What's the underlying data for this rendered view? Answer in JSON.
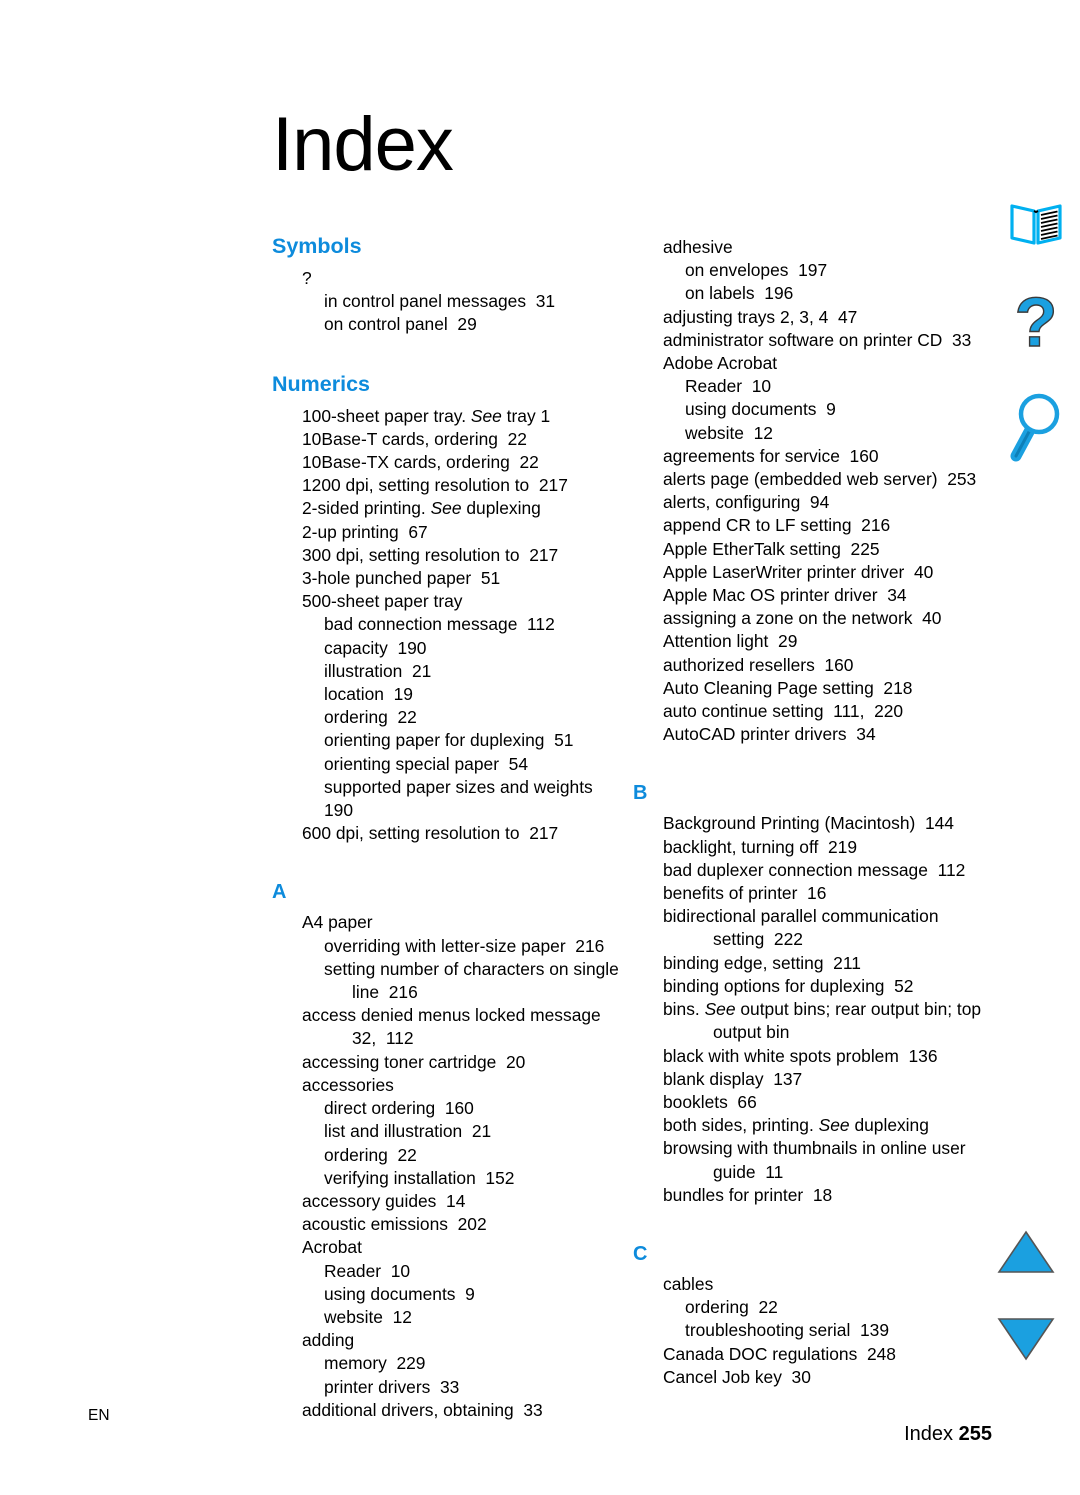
{
  "page": {
    "title": "Index",
    "footer_left": "EN",
    "footer_label": "Index",
    "footer_page": "255"
  },
  "theme": {
    "heading_blue": "#0d8bdc",
    "icon_blue": "#1ba0e0",
    "text_black": "#000000",
    "background": "#ffffff"
  },
  "icons": [
    {
      "name": "open-book-icon",
      "label": "open book"
    },
    {
      "name": "question-mark-icon",
      "label": "question mark"
    },
    {
      "name": "magnifier-icon",
      "label": "magnifying glass"
    },
    {
      "name": "triangle-up-icon",
      "label": "previous page"
    },
    {
      "name": "triangle-down-icon",
      "label": "next page"
    }
  ],
  "columns": {
    "left": [
      {
        "heading": "Symbols",
        "heading_style": "word",
        "entries": [
          {
            "level": 0,
            "text": "?"
          },
          {
            "level": 1,
            "text": "in control panel messages  31"
          },
          {
            "level": 1,
            "text": "on control panel  29"
          }
        ]
      },
      {
        "heading": "Numerics",
        "heading_style": "word",
        "entries": [
          {
            "level": 0,
            "text": "100-sheet paper tray. ",
            "italic": "See",
            "text2": " tray 1"
          },
          {
            "level": 0,
            "text": "10Base-T cards, ordering  22"
          },
          {
            "level": 0,
            "text": "10Base-TX cards, ordering  22"
          },
          {
            "level": 0,
            "text": "1200 dpi, setting resolution to  217"
          },
          {
            "level": 0,
            "text": "2-sided printing. ",
            "italic": "See",
            "text2": " duplexing"
          },
          {
            "level": 0,
            "text": "2-up printing  67"
          },
          {
            "level": 0,
            "text": "300 dpi, setting resolution to  217"
          },
          {
            "level": 0,
            "text": "3-hole punched paper  51"
          },
          {
            "level": 0,
            "text": "500-sheet paper tray"
          },
          {
            "level": 1,
            "text": "bad connection message  112"
          },
          {
            "level": 1,
            "text": "capacity  190"
          },
          {
            "level": 1,
            "text": "illustration  21"
          },
          {
            "level": 1,
            "text": "location  19"
          },
          {
            "level": 1,
            "text": "ordering  22"
          },
          {
            "level": 1,
            "text": "orienting paper for duplexing  51"
          },
          {
            "level": 1,
            "text": "orienting special paper  54"
          },
          {
            "level": 1,
            "text": "supported paper sizes and weights  190"
          },
          {
            "level": 0,
            "text": "600 dpi, setting resolution to  217"
          }
        ]
      },
      {
        "heading": "A",
        "heading_style": "letter",
        "entries": [
          {
            "level": 0,
            "text": "A4 paper"
          },
          {
            "level": 1,
            "text": "overriding with letter-size paper  216"
          },
          {
            "level": 1,
            "text": "setting number of characters on single"
          },
          {
            "level": 2,
            "text": "line  216"
          },
          {
            "level": 0,
            "text": "access denied menus locked message"
          },
          {
            "level": 2,
            "text": "32,  112"
          },
          {
            "level": 0,
            "text": "accessing toner cartridge  20"
          },
          {
            "level": 0,
            "text": "accessories"
          },
          {
            "level": 1,
            "text": "direct ordering  160"
          },
          {
            "level": 1,
            "text": "list and illustration  21"
          },
          {
            "level": 1,
            "text": "ordering  22"
          },
          {
            "level": 1,
            "text": "verifying installation  152"
          },
          {
            "level": 0,
            "text": "accessory guides  14"
          },
          {
            "level": 0,
            "text": "acoustic emissions  202"
          },
          {
            "level": 0,
            "text": "Acrobat"
          },
          {
            "level": 1,
            "text": "Reader  10"
          },
          {
            "level": 1,
            "text": "using documents  9"
          },
          {
            "level": 1,
            "text": "website  12"
          },
          {
            "level": 0,
            "text": "adding"
          },
          {
            "level": 1,
            "text": "memory  229"
          },
          {
            "level": 1,
            "text": "printer drivers  33"
          },
          {
            "level": 0,
            "text": "additional drivers, obtaining  33"
          }
        ]
      }
    ],
    "right": [
      {
        "heading": "",
        "heading_style": "none",
        "entries": [
          {
            "level": 0,
            "text": "adhesive"
          },
          {
            "level": 1,
            "text": "on envelopes  197"
          },
          {
            "level": 1,
            "text": "on labels  196"
          },
          {
            "level": 0,
            "text": "adjusting trays 2, 3, 4  47"
          },
          {
            "level": 0,
            "text": "administrator software on printer CD  33"
          },
          {
            "level": 0,
            "text": "Adobe Acrobat"
          },
          {
            "level": 1,
            "text": "Reader  10"
          },
          {
            "level": 1,
            "text": "using documents  9"
          },
          {
            "level": 1,
            "text": "website  12"
          },
          {
            "level": 0,
            "text": "agreements for service  160"
          },
          {
            "level": 0,
            "text": "alerts page (embedded web server)  253"
          },
          {
            "level": 0,
            "text": "alerts, configuring  94"
          },
          {
            "level": 0,
            "text": "append CR to LF setting  216"
          },
          {
            "level": 0,
            "text": "Apple EtherTalk setting  225"
          },
          {
            "level": 0,
            "text": "Apple LaserWriter printer driver  40"
          },
          {
            "level": 0,
            "text": "Apple Mac OS printer driver  34"
          },
          {
            "level": 0,
            "text": "assigning a zone on the network  40"
          },
          {
            "level": 0,
            "text": "Attention light  29"
          },
          {
            "level": 0,
            "text": "authorized resellers  160"
          },
          {
            "level": 0,
            "text": "Auto Cleaning Page setting  218"
          },
          {
            "level": 0,
            "text": "auto continue setting  111,  220"
          },
          {
            "level": 0,
            "text": "AutoCAD printer drivers  34"
          }
        ]
      },
      {
        "heading": "B",
        "heading_style": "letter",
        "entries": [
          {
            "level": 0,
            "text": "Background Printing (Macintosh)  144"
          },
          {
            "level": 0,
            "text": "backlight, turning off  219"
          },
          {
            "level": 0,
            "text": "bad duplexer connection message  112"
          },
          {
            "level": 0,
            "text": "benefits of printer  16"
          },
          {
            "level": 0,
            "text": "bidirectional parallel communication"
          },
          {
            "level": 2,
            "text": "setting  222"
          },
          {
            "level": 0,
            "text": "binding edge, setting  211"
          },
          {
            "level": 0,
            "text": "binding options for duplexing  52"
          },
          {
            "level": 0,
            "text": "bins. ",
            "italic": "See",
            "text2": " output bins; rear output bin; top"
          },
          {
            "level": 2,
            "text": "output bin"
          },
          {
            "level": 0,
            "text": "black with white spots problem  136"
          },
          {
            "level": 0,
            "text": "blank display  137"
          },
          {
            "level": 0,
            "text": "booklets  66"
          },
          {
            "level": 0,
            "text": "both sides, printing. ",
            "italic": "See",
            "text2": " duplexing"
          },
          {
            "level": 0,
            "text": "browsing with thumbnails in online user"
          },
          {
            "level": 2,
            "text": "guide  11"
          },
          {
            "level": 0,
            "text": "bundles for printer  18"
          }
        ]
      },
      {
        "heading": "C",
        "heading_style": "letter",
        "entries": [
          {
            "level": 0,
            "text": "cables"
          },
          {
            "level": 1,
            "text": "ordering  22"
          },
          {
            "level": 1,
            "text": "troubleshooting serial  139"
          },
          {
            "level": 0,
            "text": "Canada DOC regulations  248"
          },
          {
            "level": 0,
            "text": "Cancel Job key  30"
          }
        ]
      }
    ]
  }
}
